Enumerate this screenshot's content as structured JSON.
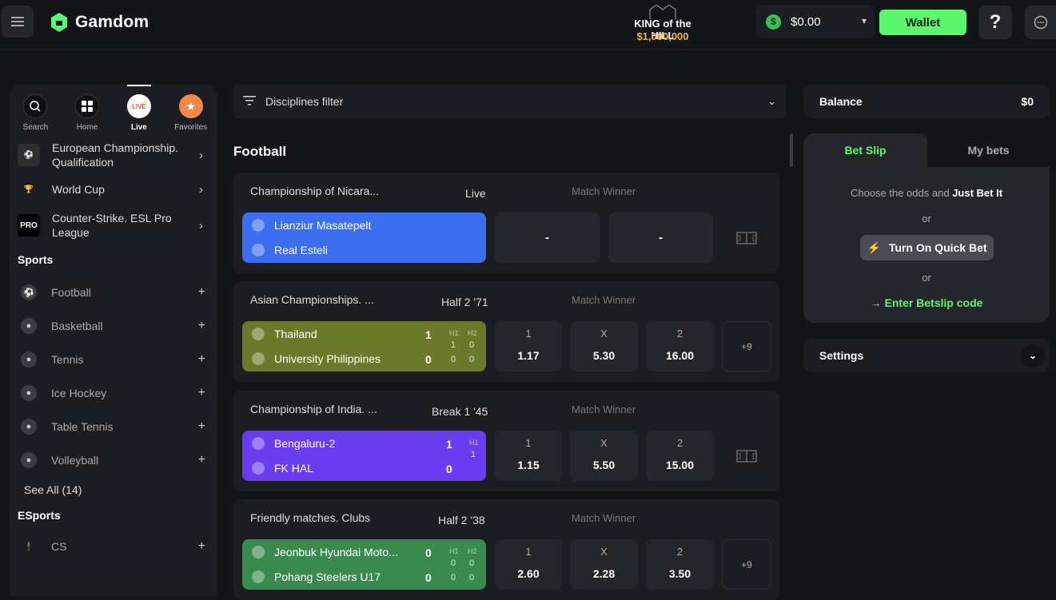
{
  "header": {
    "logo": "Gamdom",
    "koth_title": "KING of the HILL",
    "koth_prize": "$1,000,000",
    "balance": "$0.00",
    "coin_symbol": "$",
    "wallet_label": "Wallet",
    "help_label": "?"
  },
  "nav": [
    {
      "label": "Search"
    },
    {
      "label": "Home"
    },
    {
      "label": "Live"
    },
    {
      "label": "Favorites"
    }
  ],
  "live_badge": "LIVE",
  "competitions": [
    {
      "label": "European Championship. Qualification"
    },
    {
      "label": "World Cup"
    },
    {
      "label": "Counter-Strike. ESL Pro League",
      "badge": "PRO"
    }
  ],
  "sports_title": "Sports",
  "sports": [
    {
      "label": "Football"
    },
    {
      "label": "Basketball"
    },
    {
      "label": "Tennis"
    },
    {
      "label": "Ice Hockey"
    },
    {
      "label": "Table Tennis"
    },
    {
      "label": "Volleyball"
    }
  ],
  "see_all": "See All (14)",
  "esports_title": "ESports",
  "esports": [
    {
      "label": "CS"
    }
  ],
  "filter_label": "Disciplines filter",
  "section_title": "Football",
  "market_label": "Match Winner",
  "matches": [
    {
      "competition": "Championship of Nicara...",
      "status": "Live",
      "team1": "Lianziur Masatepelt",
      "team2": "Real Esteli",
      "color": "#3d6ef0",
      "odds": [
        "-",
        "-"
      ]
    },
    {
      "competition": "Asian Championships. ...",
      "status": "Half 2 '71",
      "team1": "Thailand",
      "team2": "University Philippines",
      "color": "#6b7a2a",
      "score1": "1",
      "score2": "0",
      "h1_label": "H1",
      "h2_label": "H2",
      "h1a": "1",
      "h1b": "0",
      "h2a": "0",
      "h2b": "0",
      "odds_labels": [
        "1",
        "X",
        "2"
      ],
      "odds": [
        "1.17",
        "5.30",
        "16.00"
      ],
      "more": "+9"
    },
    {
      "competition": "Championship of India. ...",
      "status": "Break 1 '45",
      "team1": "Bengaluru-2",
      "team2": "FK HAL",
      "color": "#6a3df0",
      "score1": "1",
      "score2": "0",
      "h1_label": "H1",
      "h1a": "1",
      "odds_labels": [
        "1",
        "X",
        "2"
      ],
      "odds": [
        "1.15",
        "5.50",
        "15.00"
      ]
    },
    {
      "competition": "Friendly matches. Clubs",
      "status": "Half 2 '38",
      "team1": "Jeonbuk Hyundai Moto...",
      "team2": "Pohang Steelers U17",
      "color": "#3a8a4f",
      "score1": "0",
      "score2": "0",
      "h1_label": "H1",
      "h2_label": "H2",
      "h1a": "0",
      "h1b": "0",
      "h2a": "0",
      "h2b": "0",
      "odds_labels": [
        "1",
        "X",
        "2"
      ],
      "odds": [
        "2.60",
        "2.28",
        "3.50"
      ],
      "more": "+9"
    }
  ],
  "right": {
    "balance_label": "Balance",
    "balance_value": "$0",
    "tab_betslip": "Bet Slip",
    "tab_mybets": "My bets",
    "choose_text": "Choose the odds and",
    "just_bet": "Just Bet It",
    "or": "or",
    "quick_bet": "Turn On Quick Bet",
    "enter_code": "→ Enter Betslip code",
    "settings": "Settings"
  }
}
